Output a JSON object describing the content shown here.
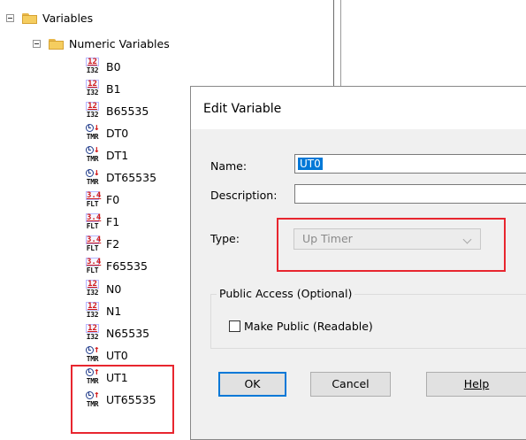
{
  "tree": {
    "root_label": "Variables",
    "folder_label": "Numeric Variables",
    "items": [
      {
        "label": "B0",
        "icon": "int32-variable-icon",
        "top": "12",
        "bottom": "I32"
      },
      {
        "label": "B1",
        "icon": "int32-variable-icon",
        "top": "12",
        "bottom": "I32"
      },
      {
        "label": "B65535",
        "icon": "int32-variable-icon",
        "top": "12",
        "bottom": "I32"
      },
      {
        "label": "DT0",
        "icon": "down-timer-icon",
        "bottom": "TMR"
      },
      {
        "label": "DT1",
        "icon": "down-timer-icon",
        "bottom": "TMR"
      },
      {
        "label": "DT65535",
        "icon": "down-timer-icon",
        "bottom": "TMR"
      },
      {
        "label": "F0",
        "icon": "float-variable-icon",
        "top": "3.4",
        "bottom": "FLT"
      },
      {
        "label": "F1",
        "icon": "float-variable-icon",
        "top": "3.4",
        "bottom": "FLT"
      },
      {
        "label": "F2",
        "icon": "float-variable-icon",
        "top": "3.4",
        "bottom": "FLT"
      },
      {
        "label": "F65535",
        "icon": "float-variable-icon",
        "top": "3.4",
        "bottom": "FLT"
      },
      {
        "label": "N0",
        "icon": "int32-variable-icon",
        "top": "12",
        "bottom": "I32"
      },
      {
        "label": "N1",
        "icon": "int32-variable-icon",
        "top": "12",
        "bottom": "I32"
      },
      {
        "label": "N65535",
        "icon": "int32-variable-icon",
        "top": "12",
        "bottom": "I32"
      },
      {
        "label": "UT0",
        "icon": "up-timer-icon",
        "bottom": "TMR"
      },
      {
        "label": "UT1",
        "icon": "up-timer-icon",
        "bottom": "TMR"
      },
      {
        "label": "UT65535",
        "icon": "up-timer-icon",
        "bottom": "TMR"
      }
    ]
  },
  "dialog": {
    "title": "Edit Variable",
    "name_label": "Name:",
    "name_value": "UT0",
    "description_label": "Description:",
    "description_value": "",
    "type_label": "Type:",
    "type_value": "Up Timer",
    "public_group_label": "Public Access (Optional)",
    "make_public_label": "Make Public (Readable)",
    "make_public_checked": false,
    "ok_label": "OK",
    "cancel_label": "Cancel",
    "help_label": "Help"
  },
  "colors": {
    "highlight": "#e8262f",
    "selection": "#0078d7"
  }
}
